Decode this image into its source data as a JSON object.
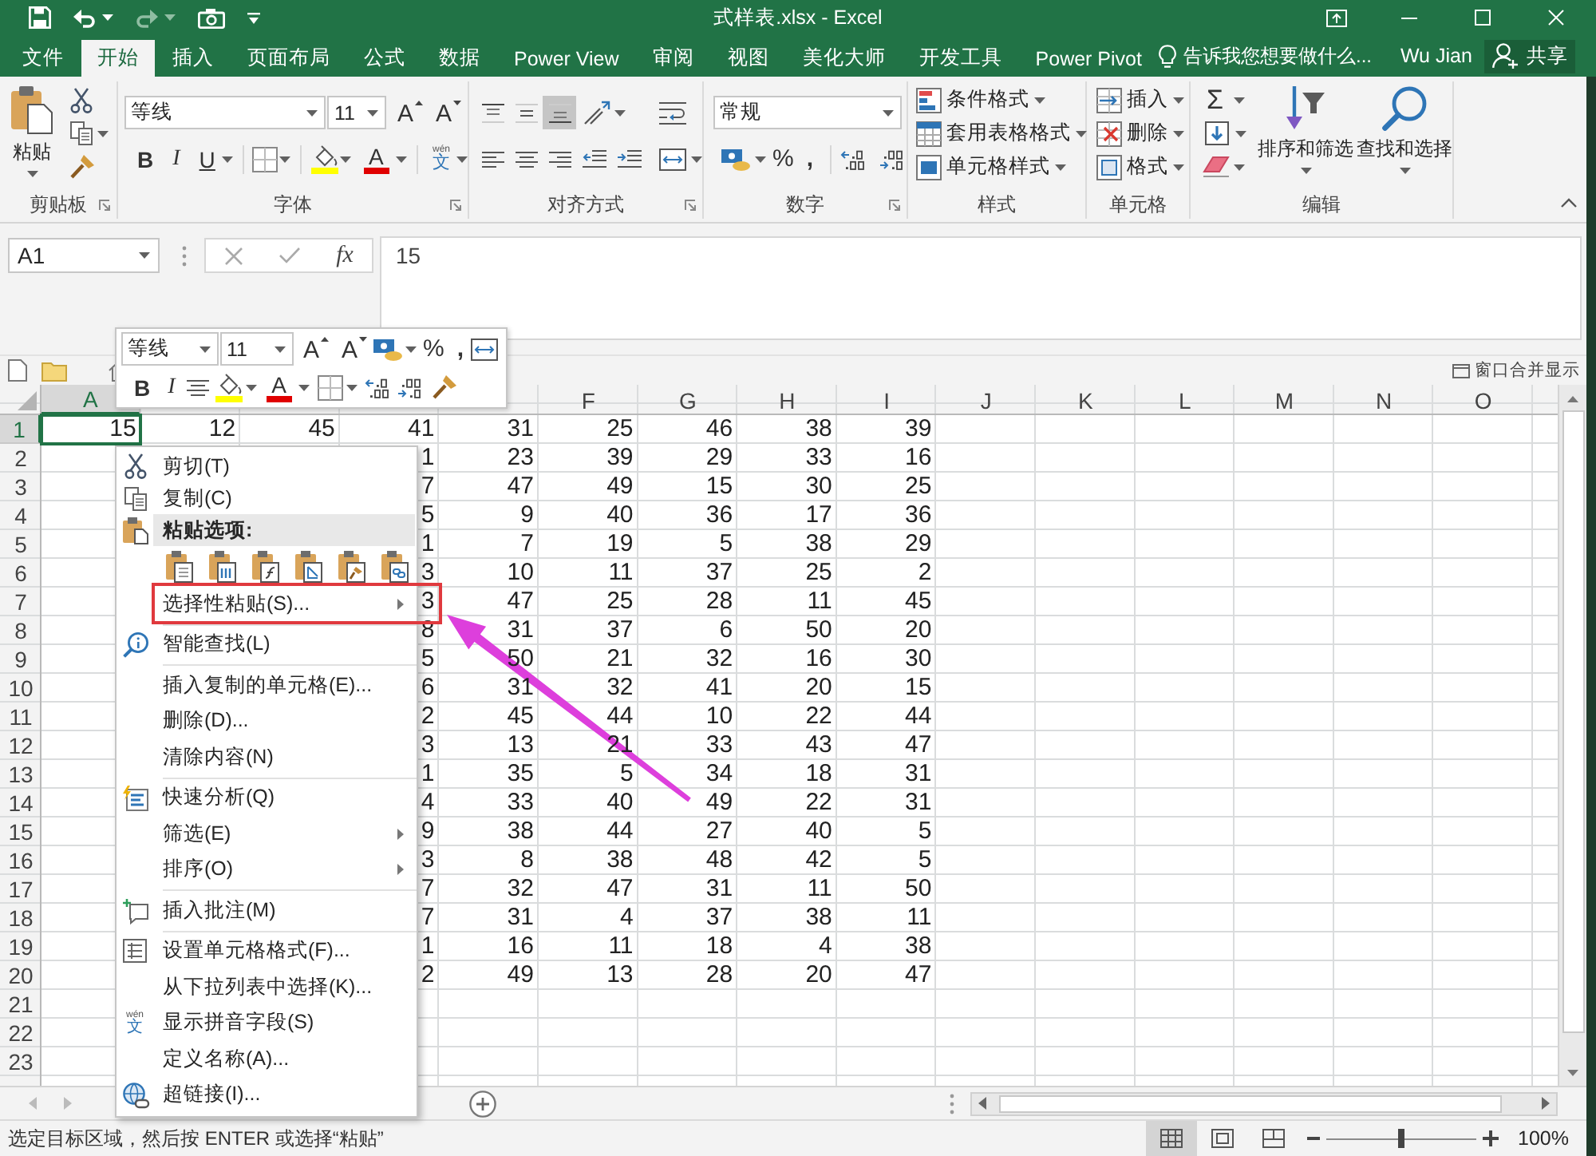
{
  "title_bar": {
    "quick_access": [
      {
        "kind": "save",
        "disabled": false
      },
      {
        "kind": "undo",
        "disabled": false
      },
      {
        "kind": "redo",
        "disabled": true
      },
      {
        "kind": "camera",
        "disabled": false
      },
      {
        "kind": "customize",
        "disabled": false
      }
    ],
    "title": "式样表.xlsx - Excel"
  },
  "tabs": [
    {
      "label": "文件",
      "selected": false
    },
    {
      "label": "开始",
      "selected": true
    },
    {
      "label": "插入",
      "selected": false
    },
    {
      "label": "页面布局",
      "selected": false
    },
    {
      "label": "公式",
      "selected": false
    },
    {
      "label": "数据",
      "selected": false
    },
    {
      "label": "Power View",
      "selected": false
    },
    {
      "label": "审阅",
      "selected": false
    },
    {
      "label": "视图",
      "selected": false
    },
    {
      "label": "美化大师",
      "selected": false
    },
    {
      "label": "开发工具",
      "selected": false
    },
    {
      "label": "Power Pivot",
      "selected": false
    }
  ],
  "tell_me": {
    "placeholder": "告诉我您想要做什么..."
  },
  "account": {
    "user": "Wu Jian",
    "share": "共享"
  },
  "ribbon": {
    "clipboard": {
      "paste": "粘贴",
      "label": "剪贴板"
    },
    "font": {
      "font_name": "等线",
      "font_size": "11",
      "grow": "A",
      "shrink": "A",
      "bold": "B",
      "italic": "I",
      "underline": "U",
      "font_color": "A",
      "phonetic": [
        "wén",
        "文"
      ],
      "label": "字体"
    },
    "alignment": {
      "vertical": [
        {
          "selected": false
        },
        {
          "selected": false
        },
        {
          "selected": true
        }
      ],
      "label": "对齐方式"
    },
    "number": {
      "format": "常规",
      "percent": "%",
      "comma": ",",
      "label": "数字"
    },
    "styles": {
      "items": [
        "条件格式",
        "套用表格格式",
        "单元格样式"
      ],
      "label": "样式"
    },
    "cells": {
      "items": [
        "插入",
        "删除",
        "格式"
      ],
      "label": "单元格"
    },
    "editing": {
      "autosum": "Σ",
      "sort": "排序和筛选",
      "find": "查找和选择",
      "label": "编辑"
    }
  },
  "formula_bar": {
    "name_box": "A1",
    "function_label": "fx",
    "value": "15"
  },
  "sheet_toolbar": {
    "merge_windows": "窗口合并显示"
  },
  "grid": {
    "columns": [
      {
        "header": "A",
        "selected": true,
        "cells": [
          "15"
        ]
      },
      {
        "selected": false,
        "cells": [
          "12"
        ]
      },
      {
        "selected": false,
        "cells": [
          "45"
        ]
      },
      {
        "selected": false,
        "cells": [
          "41",
          "1",
          "7",
          "5",
          "1",
          "3",
          "3",
          "8",
          "5",
          "6",
          "2",
          "3",
          "1",
          "4",
          "9",
          "3",
          "7",
          "7",
          "1",
          "2"
        ]
      },
      {
        "selected": false,
        "cells": [
          "31",
          "23",
          "47",
          "9",
          "7",
          "10",
          "47",
          "31",
          "50",
          "31",
          "45",
          "13",
          "35",
          "33",
          "38",
          "8",
          "32",
          "31",
          "16",
          "49"
        ]
      },
      {
        "header": "F",
        "selected": false,
        "cells": [
          "25",
          "39",
          "49",
          "40",
          "19",
          "11",
          "25",
          "37",
          "21",
          "32",
          "44",
          "21",
          "5",
          "40",
          "44",
          "38",
          "47",
          "4",
          "11",
          "13"
        ]
      },
      {
        "header": "G",
        "selected": false,
        "cells": [
          "46",
          "29",
          "15",
          "36",
          "5",
          "37",
          "28",
          "6",
          "32",
          "41",
          "10",
          "33",
          "34",
          "49",
          "27",
          "48",
          "31",
          "37",
          "18",
          "28"
        ]
      },
      {
        "header": "H",
        "selected": false,
        "cells": [
          "38",
          "33",
          "30",
          "17",
          "38",
          "25",
          "11",
          "50",
          "16",
          "20",
          "22",
          "43",
          "18",
          "22",
          "40",
          "42",
          "11",
          "38",
          "4",
          "20"
        ]
      },
      {
        "header": "I",
        "selected": false,
        "cells": [
          "39",
          "16",
          "25",
          "36",
          "29",
          "2",
          "45",
          "20",
          "30",
          "15",
          "44",
          "47",
          "31",
          "31",
          "5",
          "5",
          "50",
          "11",
          "38",
          "47"
        ]
      },
      {
        "header": "J",
        "selected": false
      },
      {
        "header": "K",
        "selected": false
      },
      {
        "header": "L",
        "selected": false
      },
      {
        "header": "M",
        "selected": false
      },
      {
        "header": "N",
        "selected": false
      },
      {
        "header": "O",
        "selected": false
      }
    ],
    "rows": [
      {
        "label": "1",
        "selected": true
      },
      {
        "label": "2",
        "selected": false
      },
      {
        "label": "3",
        "selected": false
      },
      {
        "label": "4",
        "selected": false
      },
      {
        "label": "5",
        "selected": false
      },
      {
        "label": "6",
        "selected": false
      },
      {
        "label": "7",
        "selected": false
      },
      {
        "label": "8",
        "selected": false
      },
      {
        "label": "9",
        "selected": false
      },
      {
        "label": "10",
        "selected": false
      },
      {
        "label": "11",
        "selected": false
      },
      {
        "label": "12",
        "selected": false
      },
      {
        "label": "13",
        "selected": false
      },
      {
        "label": "14",
        "selected": false
      },
      {
        "label": "15",
        "selected": false
      },
      {
        "label": "16",
        "selected": false
      },
      {
        "label": "17",
        "selected": false
      },
      {
        "label": "18",
        "selected": false
      },
      {
        "label": "19",
        "selected": false
      },
      {
        "label": "20",
        "selected": false
      },
      {
        "label": "21",
        "selected": false
      },
      {
        "label": "22",
        "selected": false
      },
      {
        "label": "23",
        "selected": false
      }
    ]
  },
  "mini_toolbar": {
    "font_name": "等线",
    "font_size": "11",
    "grow": "A",
    "shrink": "A",
    "percent": "%",
    "comma": ",",
    "bold": "B",
    "italic": "I",
    "font_color": "A"
  },
  "context_menu": {
    "items": [
      {
        "kind": "item",
        "label": "剪切(T)",
        "submenu": false,
        "highlighted": false
      },
      {
        "kind": "item",
        "label": "复制(C)",
        "submenu": false,
        "highlighted": false
      },
      {
        "kind": "header",
        "label": "粘贴选项:"
      },
      {
        "kind": "paste_options"
      },
      {
        "kind": "item",
        "label": "选择性粘贴(S)...",
        "submenu": true,
        "highlighted": true
      },
      {
        "kind": "separator"
      },
      {
        "kind": "item",
        "label": "智能查找(L)",
        "submenu": false,
        "highlighted": false
      },
      {
        "kind": "separator"
      },
      {
        "kind": "item",
        "label": "插入复制的单元格(E)...",
        "submenu": false,
        "highlighted": false
      },
      {
        "kind": "item",
        "label": "删除(D)...",
        "submenu": false,
        "highlighted": false
      },
      {
        "kind": "item",
        "label": "清除内容(N)",
        "submenu": false,
        "highlighted": false
      },
      {
        "kind": "separator"
      },
      {
        "kind": "item",
        "label": "快速分析(Q)",
        "submenu": false,
        "highlighted": false
      },
      {
        "kind": "item",
        "label": "筛选(E)",
        "submenu": true,
        "highlighted": false
      },
      {
        "kind": "item",
        "label": "排序(O)",
        "submenu": true,
        "highlighted": false
      },
      {
        "kind": "separator"
      },
      {
        "kind": "item",
        "label": "插入批注(M)",
        "submenu": false,
        "highlighted": false
      },
      {
        "kind": "separator"
      },
      {
        "kind": "item",
        "label": "设置单元格格式(F)...",
        "submenu": false,
        "highlighted": false
      },
      {
        "kind": "item",
        "label": "从下拉列表中选择(K)...",
        "submenu": false,
        "highlighted": false
      },
      {
        "kind": "item",
        "label": "显示拼音字段(S)",
        "icon_text": [
          "wén",
          "文"
        ],
        "submenu": false,
        "highlighted": false
      },
      {
        "kind": "item",
        "label": "定义名称(A)...",
        "submenu": false,
        "highlighted": false
      },
      {
        "kind": "item",
        "label": "超链接(I)...",
        "submenu": false,
        "highlighted": false
      }
    ]
  },
  "status_bar": {
    "message": "选定目标区域，然后按 ENTER 或选择“粘贴”",
    "views": [
      {
        "selected": true
      },
      {
        "selected": false
      },
      {
        "selected": false
      }
    ],
    "zoom": {
      "level": 0.5,
      "reading": "100%"
    }
  }
}
